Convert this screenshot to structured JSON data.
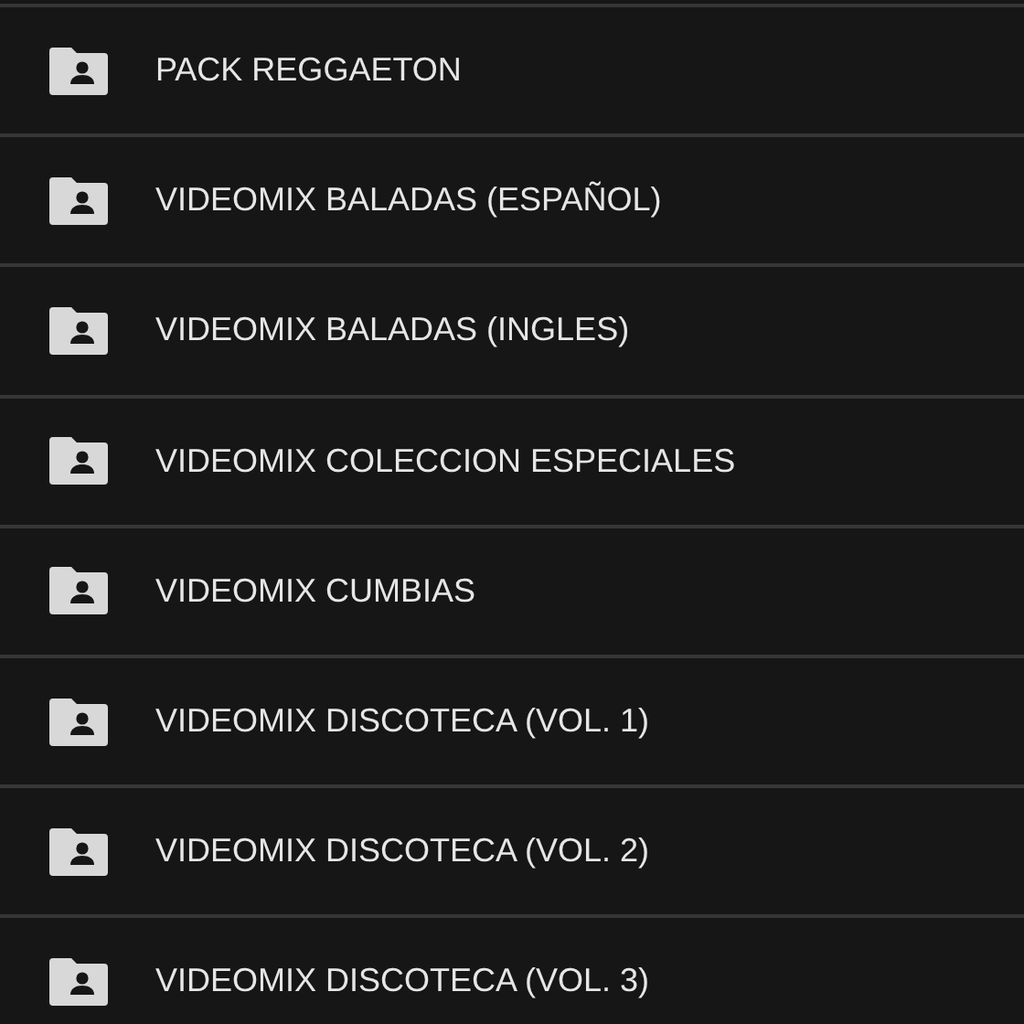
{
  "folders": [
    {
      "name": "PACK REGGAETON"
    },
    {
      "name": "VIDEOMIX BALADAS (ESPAÑOL)"
    },
    {
      "name": "VIDEOMIX BALADAS (INGLES)"
    },
    {
      "name": "VIDEOMIX COLECCION ESPECIALES"
    },
    {
      "name": "VIDEOMIX CUMBIAS"
    },
    {
      "name": "VIDEOMIX DISCOTECA (VOL. 1)"
    },
    {
      "name": "VIDEOMIX DISCOTECA (VOL. 2)"
    },
    {
      "name": "VIDEOMIX DISCOTECA (VOL. 3)"
    }
  ]
}
